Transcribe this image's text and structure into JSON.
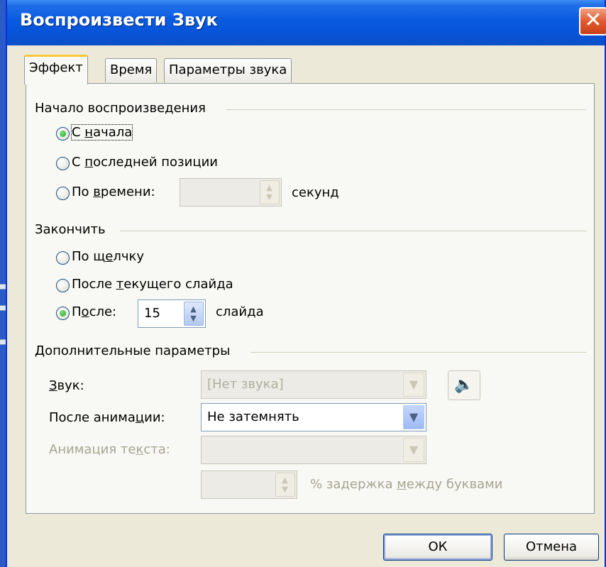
{
  "dialog": {
    "title": "Воспроизвести Звук",
    "close_glyph": "✕"
  },
  "tabs": [
    {
      "label": "Эффект",
      "active": true
    },
    {
      "label": "Время",
      "active": false
    },
    {
      "label": "Параметры звука",
      "active": false
    }
  ],
  "start_group": {
    "label": "Начало воспроизведения",
    "options": [
      {
        "pre": "С ",
        "u": "н",
        "post": "ачала",
        "checked": true
      },
      {
        "pre": "С ",
        "u": "п",
        "post": "оследней позиции",
        "checked": false
      },
      {
        "pre": "По ",
        "u": "в",
        "post": "ремени:",
        "checked": false
      }
    ],
    "time_value": "",
    "time_unit": "секунд"
  },
  "end_group": {
    "label": "Закончить",
    "options": [
      {
        "pre": "По щ",
        "u": "е",
        "post": "лчку",
        "checked": false
      },
      {
        "pre": "После ",
        "u": "т",
        "post": "екущего слайда",
        "checked": false
      },
      {
        "pre": "П",
        "u": "о",
        "post": "сле:",
        "checked": true
      }
    ],
    "after_value": "15",
    "after_unit": "слайда"
  },
  "extra_group": {
    "label": "Дополнительные параметры",
    "sound_label_u": "З",
    "sound_label_rest": "вук:",
    "sound_value": "[Нет звука]",
    "after_anim_label_pre": "После анима",
    "after_anim_label_u": "ц",
    "after_anim_label_post": "ии:",
    "after_anim_value": "Не затемнять",
    "text_anim_label_pre": "Анимация те",
    "text_anim_label_u": "к",
    "text_anim_label_post": "ста:",
    "text_anim_value": "",
    "delay_value": "",
    "delay_label_pre": "% задержка ",
    "delay_label_u": "м",
    "delay_label_post": "ежду буквами"
  },
  "buttons": {
    "ok": "ОК",
    "cancel": "Отмена"
  },
  "icons": {
    "spin": "▲▼",
    "dropdown": "▼",
    "speaker": "🔈"
  }
}
